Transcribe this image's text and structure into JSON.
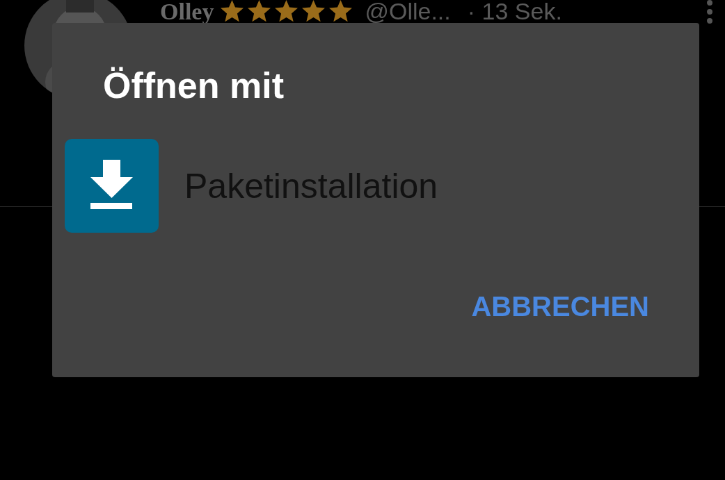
{
  "post": {
    "name": "Olley",
    "stars": 5,
    "handle": "@Olle...",
    "time": "· 13 Sek."
  },
  "dialog": {
    "title": "Öffnen mit",
    "apps": [
      {
        "label": "Paketinstallation"
      }
    ],
    "buttons": [
      "ABBRECHEN"
    ]
  }
}
